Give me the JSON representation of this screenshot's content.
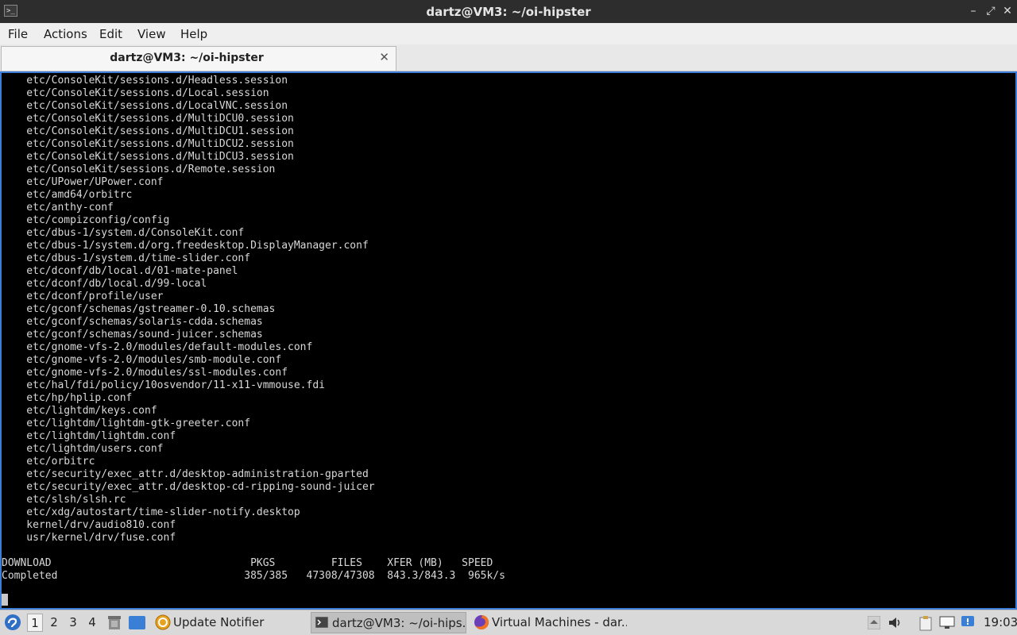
{
  "window": {
    "title": "dartz@VM3: ~/oi-hipster"
  },
  "menu": [
    "File",
    "Actions",
    "Edit",
    "View",
    "Help"
  ],
  "tab": {
    "label": "dartz@VM3: ~/oi-hipster"
  },
  "terminal": {
    "files": [
      "etc/ConsoleKit/sessions.d/Headless.session",
      "etc/ConsoleKit/sessions.d/Local.session",
      "etc/ConsoleKit/sessions.d/LocalVNC.session",
      "etc/ConsoleKit/sessions.d/MultiDCU0.session",
      "etc/ConsoleKit/sessions.d/MultiDCU1.session",
      "etc/ConsoleKit/sessions.d/MultiDCU2.session",
      "etc/ConsoleKit/sessions.d/MultiDCU3.session",
      "etc/ConsoleKit/sessions.d/Remote.session",
      "etc/UPower/UPower.conf",
      "etc/amd64/orbitrc",
      "etc/anthy-conf",
      "etc/compizconfig/config",
      "etc/dbus-1/system.d/ConsoleKit.conf",
      "etc/dbus-1/system.d/org.freedesktop.DisplayManager.conf",
      "etc/dbus-1/system.d/time-slider.conf",
      "etc/dconf/db/local.d/01-mate-panel",
      "etc/dconf/db/local.d/99-local",
      "etc/dconf/profile/user",
      "etc/gconf/schemas/gstreamer-0.10.schemas",
      "etc/gconf/schemas/solaris-cdda.schemas",
      "etc/gconf/schemas/sound-juicer.schemas",
      "etc/gnome-vfs-2.0/modules/default-modules.conf",
      "etc/gnome-vfs-2.0/modules/smb-module.conf",
      "etc/gnome-vfs-2.0/modules/ssl-modules.conf",
      "etc/hal/fdi/policy/10osvendor/11-x11-vmmouse.fdi",
      "etc/hp/hplip.conf",
      "etc/lightdm/keys.conf",
      "etc/lightdm/lightdm-gtk-greeter.conf",
      "etc/lightdm/lightdm.conf",
      "etc/lightdm/users.conf",
      "etc/orbitrc",
      "etc/security/exec_attr.d/desktop-administration-gparted",
      "etc/security/exec_attr.d/desktop-cd-ripping-sound-juicer",
      "etc/slsh/slsh.rc",
      "etc/xdg/autostart/time-slider-notify.desktop",
      "kernel/drv/audio810.conf",
      "usr/kernel/drv/fuse.conf"
    ],
    "summary_header": "DOWNLOAD                                PKGS         FILES    XFER (MB)   SPEED",
    "summary_row": "Completed                              385/385   47308/47308  843.3/843.3  965k/s"
  },
  "taskbar": {
    "workspaces": [
      "1",
      "2",
      "3",
      "4"
    ],
    "active_workspace": "1",
    "tasks": [
      {
        "label": "Update Notifier",
        "icon": "update-notifier-icon"
      },
      {
        "label": "dartz@VM3: ~/oi-hips...",
        "icon": "terminal-icon"
      },
      {
        "label": "Virtual Machines - dar...",
        "icon": "firefox-icon"
      }
    ],
    "clock": "19:03"
  },
  "colors": {
    "terminal_bg": "#000000",
    "terminal_fg": "#d8d8d8",
    "focus_border": "#3b7dd8",
    "titlebar": "#2d2d2d"
  }
}
